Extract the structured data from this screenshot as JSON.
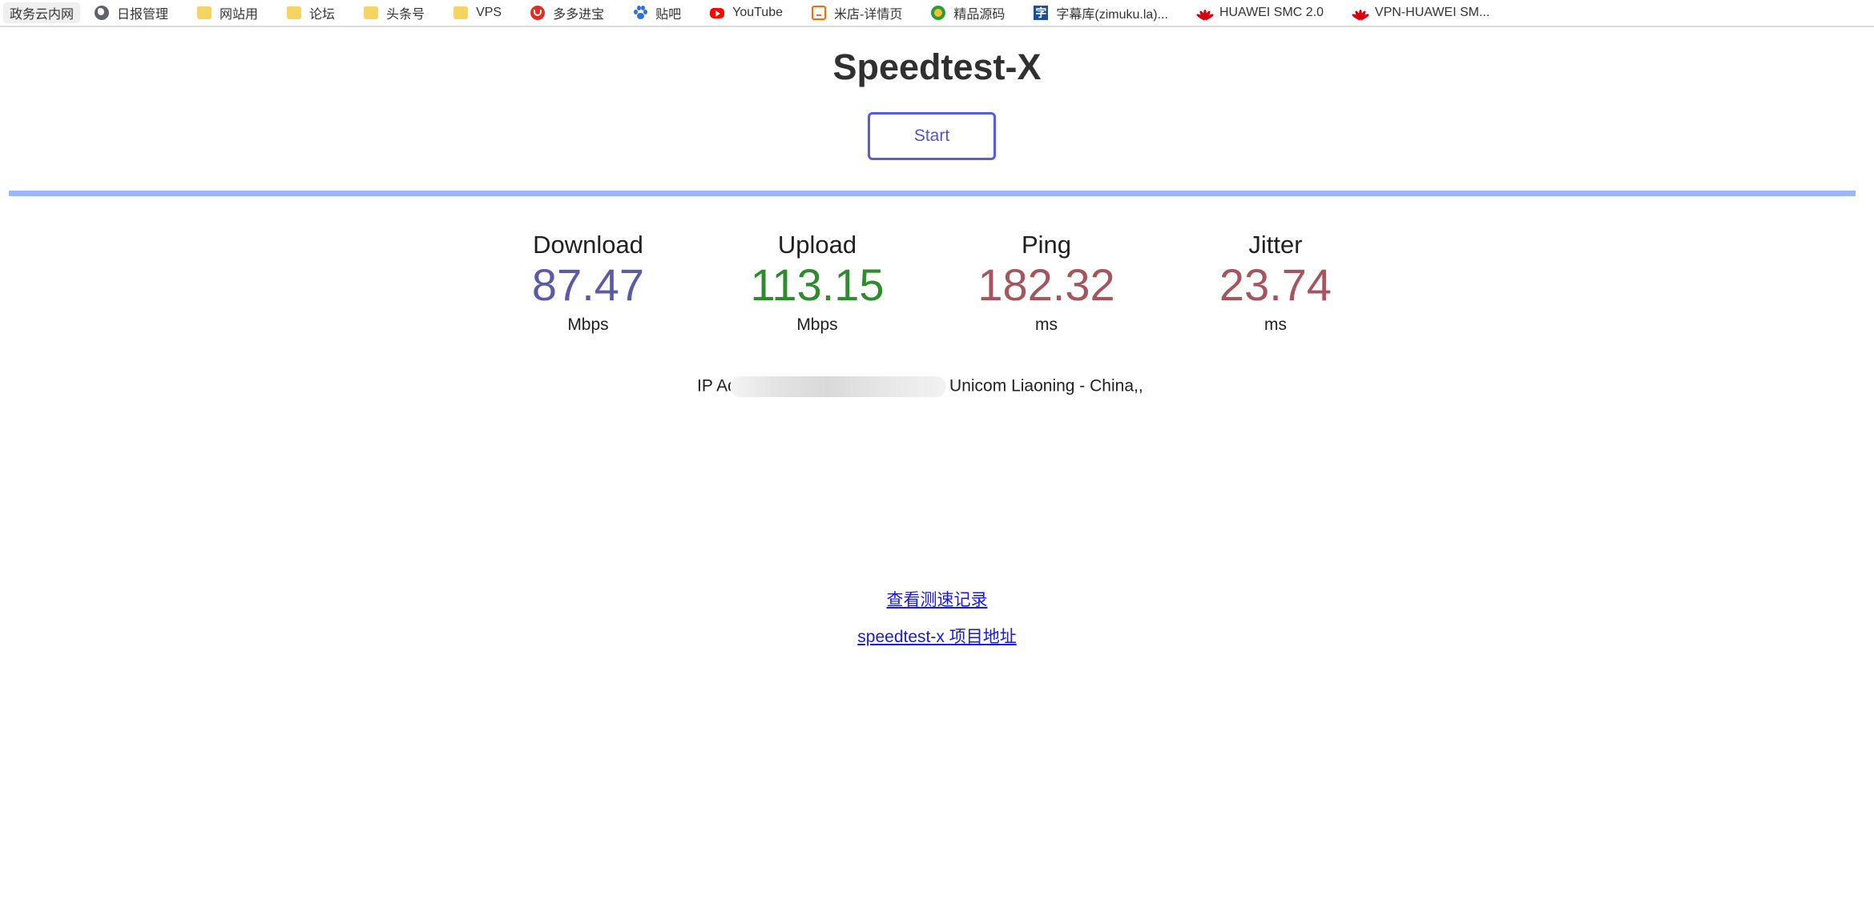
{
  "bookmarks": [
    {
      "label": "政务云内网",
      "icon": ""
    },
    {
      "label": "日报管理",
      "icon": "globe-icon"
    },
    {
      "label": "网站用",
      "icon": "folder-icon"
    },
    {
      "label": "论坛",
      "icon": "folder-icon"
    },
    {
      "label": "头条号",
      "icon": "folder-icon"
    },
    {
      "label": "VPS",
      "icon": "folder-icon"
    },
    {
      "label": "多多进宝",
      "icon": "pinduoduo-icon"
    },
    {
      "label": "贴吧",
      "icon": "baidu-paw-icon"
    },
    {
      "label": "YouTube",
      "icon": "youtube-icon"
    },
    {
      "label": "米店-详情页",
      "icon": "mi-store-icon"
    },
    {
      "label": "精品源码",
      "icon": "source-code-icon"
    },
    {
      "label": "字幕库(zimuku.la)...",
      "icon": "zimuku-icon"
    },
    {
      "label": "HUAWEI SMC 2.0",
      "icon": "huawei-icon"
    },
    {
      "label": "VPN-HUAWEI SM...",
      "icon": "huawei-icon"
    }
  ],
  "page": {
    "title": "Speedtest-X",
    "start_label": "Start",
    "progress": 1.0
  },
  "metrics": {
    "download": {
      "label": "Download",
      "value": "87.47",
      "unit": "Mbps",
      "color": "#5a5aa8"
    },
    "upload": {
      "label": "Upload",
      "value": "113.15",
      "unit": "Mbps",
      "color": "#2e8b2e"
    },
    "ping": {
      "label": "Ping",
      "value": "182.32",
      "unit": "ms",
      "color": "#a5555e"
    },
    "jitter": {
      "label": "Jitter",
      "value": "23.74",
      "unit": "ms",
      "color": "#a5555e"
    }
  },
  "ip_info": {
    "prefix": "IP Address",
    "suffix": "ina Unicom Liaoning - China,,"
  },
  "links": {
    "history": "查看测速记录",
    "project": "speedtest-x 项目地址"
  }
}
